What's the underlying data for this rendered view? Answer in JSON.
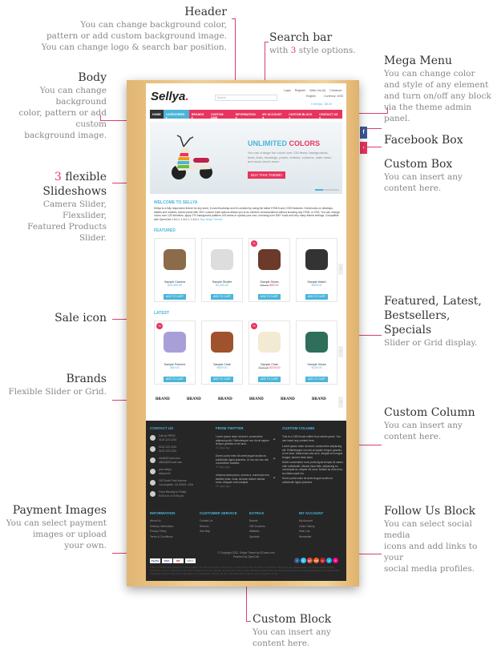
{
  "annotations": {
    "header": {
      "title": "Header",
      "lines": [
        "You can change background color,",
        "pattern or add custom background image.",
        "You can change logo & search bar position."
      ]
    },
    "search": {
      "title": "Search bar",
      "pre": "with ",
      "num": "3",
      "post": " style options."
    },
    "mega": {
      "title": "Mega Menu",
      "lines": [
        "You can change color",
        "and style of any element",
        "and turn on/off any block",
        "via the theme admin panel."
      ]
    },
    "body": {
      "title": "Body",
      "lines": [
        "You can change background",
        "color, pattern or add custom",
        "background image."
      ]
    },
    "slides": {
      "num": "3",
      "title": " flexible Slideshows",
      "lines": [
        "Camera Slider, Flexslider,",
        "Featured Products Slider."
      ]
    },
    "sale": {
      "title": "Sale icon"
    },
    "brands": {
      "title": "Brands",
      "lines": [
        "Flexible Slider or Grid."
      ]
    },
    "payment": {
      "title": "Payment Images",
      "lines": [
        "You can select payment",
        "images or upload",
        "your own."
      ]
    },
    "facebook": {
      "title": "Facebook Box"
    },
    "custombox": {
      "title": "Custom Box",
      "lines": [
        "You can insert any",
        "content here."
      ]
    },
    "featured": {
      "title": "Featured, Latest,",
      "title2": "Bestsellers, Specials",
      "lines": [
        "Slider or Grid display."
      ]
    },
    "customcol": {
      "title": "Custom Column",
      "lines": [
        "You can insert any",
        "content here."
      ]
    },
    "follow": {
      "title": "Follow Us Block",
      "lines": [
        "You can select social media",
        "icons and add links to your",
        "social media profiles."
      ]
    },
    "customblock": {
      "title": "Custom Block",
      "lines": [
        "You can insert any",
        "content here."
      ]
    }
  },
  "site": {
    "logo": "Sellya",
    "logo_dot": ".",
    "top_links": [
      "Login",
      "Register",
      "Wish List (0)",
      "Checkout"
    ],
    "language": "English",
    "currency": "Currency: USD",
    "search_placeholder": "Search",
    "cart": "0 item(s) - $0.00",
    "nav": [
      "HOME",
      "CATEGORIES ▾",
      "BRANDS ▾",
      "CUSTOM LINK",
      "INFORMATION ▾",
      "MY ACCOUNT ▾",
      "CUSTOM BLOCK ▾",
      "CONTACT US ▾"
    ],
    "slider": {
      "title1": "UNLIMITED",
      "title2": "COLORS",
      "text": "You can change the colors over 130 items: backgrounds, texts, links, headings, prices, buttons, columns, main menu and much-much more.",
      "button": "BUY THIS THEME!"
    },
    "welcome": {
      "title": "WELCOME TO SELLYA",
      "text": "Sellya is a fully responsive theme for any store, it uses Bootstrap and it's created by using the latest HTML5 and CSS3 features. Great looks on desktops, tablets and mobiles. Admin panel with 300+ custom build options allows you to do extreme customizations without knowing any HTML or CSS. You can change colors over 130 elements, apply 270 background patterns of 8 areas or upload your own, choosing over 500+ fonts and very many theme settings. Compatible with OpenCart 1.5.0.1, 1.5.0.1, 1.5.4.1.",
      "link": "Buy Sellya Theme!"
    },
    "featured_title": "FEATURED",
    "featured": [
      {
        "name": "Sample Camera",
        "price": "$29,999.00"
      },
      {
        "name": "Sample Stroller",
        "price": "$1,099.00"
      },
      {
        "name": "Sample Shoes",
        "old": "$99.00",
        "price": "$89.00",
        "sale": "%"
      },
      {
        "name": "Sample Watch",
        "price": "$539.00"
      }
    ],
    "latest_title": "LATEST",
    "latest": [
      {
        "name": "Sample Perfume",
        "price": "$59.00",
        "sale": "%"
      },
      {
        "name": "Sample Chair",
        "price": "$529.00"
      },
      {
        "name": "Sample Chair",
        "old": "$150.00",
        "price": "$139.00",
        "sale": "%"
      },
      {
        "name": "Sample Shoes",
        "price": "$199.00"
      }
    ],
    "add_to_cart": "ADD TO CART",
    "brand_label": "BRAND",
    "footer": {
      "contact_title": "CONTACT US",
      "twitter_title": "FROM TWITTER",
      "custom_title": "CUSTOM COLUMN",
      "contact": [
        "Call us FREE!\n0123 123 1234",
        "0123 123 1234\n0123 123 1234",
        "info@321cart.com\noffice@321cart.com",
        "your.sellya\nsellya.info",
        "100 South Park Avenue\nLos Angeles, CA 90024, USA",
        "From Monday to Friday\n9:00 a.m. to 5:00 p.m."
      ],
      "tweets": [
        "Lorem ipsum dolor sit amet, consectetur adipiscing elit. Pellentesque non dui at sapien tempor gravida ut vel arcu.",
        "Donec porta enim sit amet augue iaculis eu sollicitudin ligula pharetra. Ut nec dui nec nisi consectetur sodales.",
        "Vivamus diam purus, cursus a, commodo non, facilisis vitae, nulla. Aenean dictum lacinia tortor. Aliquam erat volutpat."
      ],
      "tweet_time": "22 days ago",
      "custom_text": [
        "This is a CMS block edited from admin panel. You can insert any content here.",
        "Lorem ipsum dolor sit amet, consectetur adipiscing elit. Pellentesque non dui at sapien tempor gravida ut vel arcu. Maecenas odio arcu, feugiat vel congue feugiat, laoreet vitae diam.",
        "Morbi consectetur nunc porta ligula tempor at varius nibh sollicitudin. Mauris risus felis, adipiscing eu consequat ac, aliquet vel urna. Nullam ac eros eros, ac ullamcorper leo.",
        "Donec porta enim sit amet augue iaculis eu sollicitudin ligula pharetra."
      ],
      "cols": [
        {
          "title": "INFORMATION",
          "items": [
            "About Us",
            "Delivery Information",
            "Privacy Policy",
            "Terms & Conditions"
          ]
        },
        {
          "title": "CUSTOMER SERVICE",
          "items": [
            "Contact Us",
            "Returns",
            "Site Map"
          ]
        },
        {
          "title": "EXTRAS",
          "items": [
            "Brands",
            "Gift Vouchers",
            "Affiliates",
            "Specials"
          ]
        },
        {
          "title": "MY ACCOUNT",
          "items": [
            "My Account",
            "Order History",
            "Wish List",
            "Newsletter"
          ]
        }
      ],
      "payments": [
        "PayPal",
        "VISA",
        "MC",
        "AMEX"
      ],
      "copyright": "© Copyright 2012. Sellya Theme by 321cart.com",
      "powered": "Powered by OpenCart",
      "social": [
        "f",
        "t",
        "g+",
        "rss",
        "p",
        "v",
        "fl"
      ],
      "bottom_text": "This is a CMS block edited from admin panel. You can insert any content here. Lorem ipsum dolor sit amet, consectetur adipiscing elit. Pellentesque non dui at sapien tempor gravida ut vel arcu. Maecenas odio arcu, feugiat vel congue feugiat, laoreet vitae diam. In hac habitasse platea dictumst. Morbi consectetur nunc porta ligula tempor at varius nibh sollicitudin. Mauris risus felis, adipiscing eu consequat ac, aliquet vel urna. Duis bibendum sapien nec mi egestas tempor."
    }
  },
  "colors": {
    "accent": "#e8345e",
    "blue": "#4ab5d9",
    "footer": "#262626"
  }
}
